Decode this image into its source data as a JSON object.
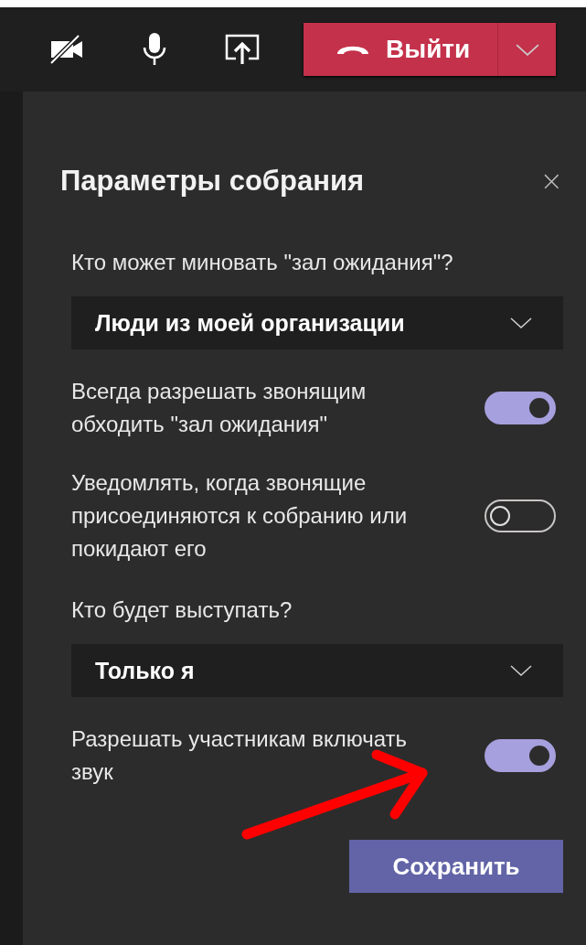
{
  "toolbar": {
    "camera_off": true,
    "end_button": "Выйти"
  },
  "panel": {
    "title": "Параметры собрания",
    "close": "×",
    "settings": [
      {
        "kind": "label",
        "text": "Кто может миновать \"зал ожидания\"?"
      },
      {
        "kind": "dropdown",
        "value": "Люди из моей организации"
      },
      {
        "kind": "toggle",
        "label": "Всегда разрешать звонящим обходить \"зал ожидания\"",
        "on": true
      },
      {
        "kind": "toggle",
        "label": "Уведомлять, когда звонящие присоединяются к собранию или покидают его",
        "on": false
      },
      {
        "kind": "label",
        "text": "Кто будет выступать?"
      },
      {
        "kind": "dropdown",
        "value": "Только я"
      },
      {
        "kind": "toggle",
        "label": "Разрешать участникам включать звук",
        "on": true
      }
    ],
    "save_button": "Сохранить"
  }
}
